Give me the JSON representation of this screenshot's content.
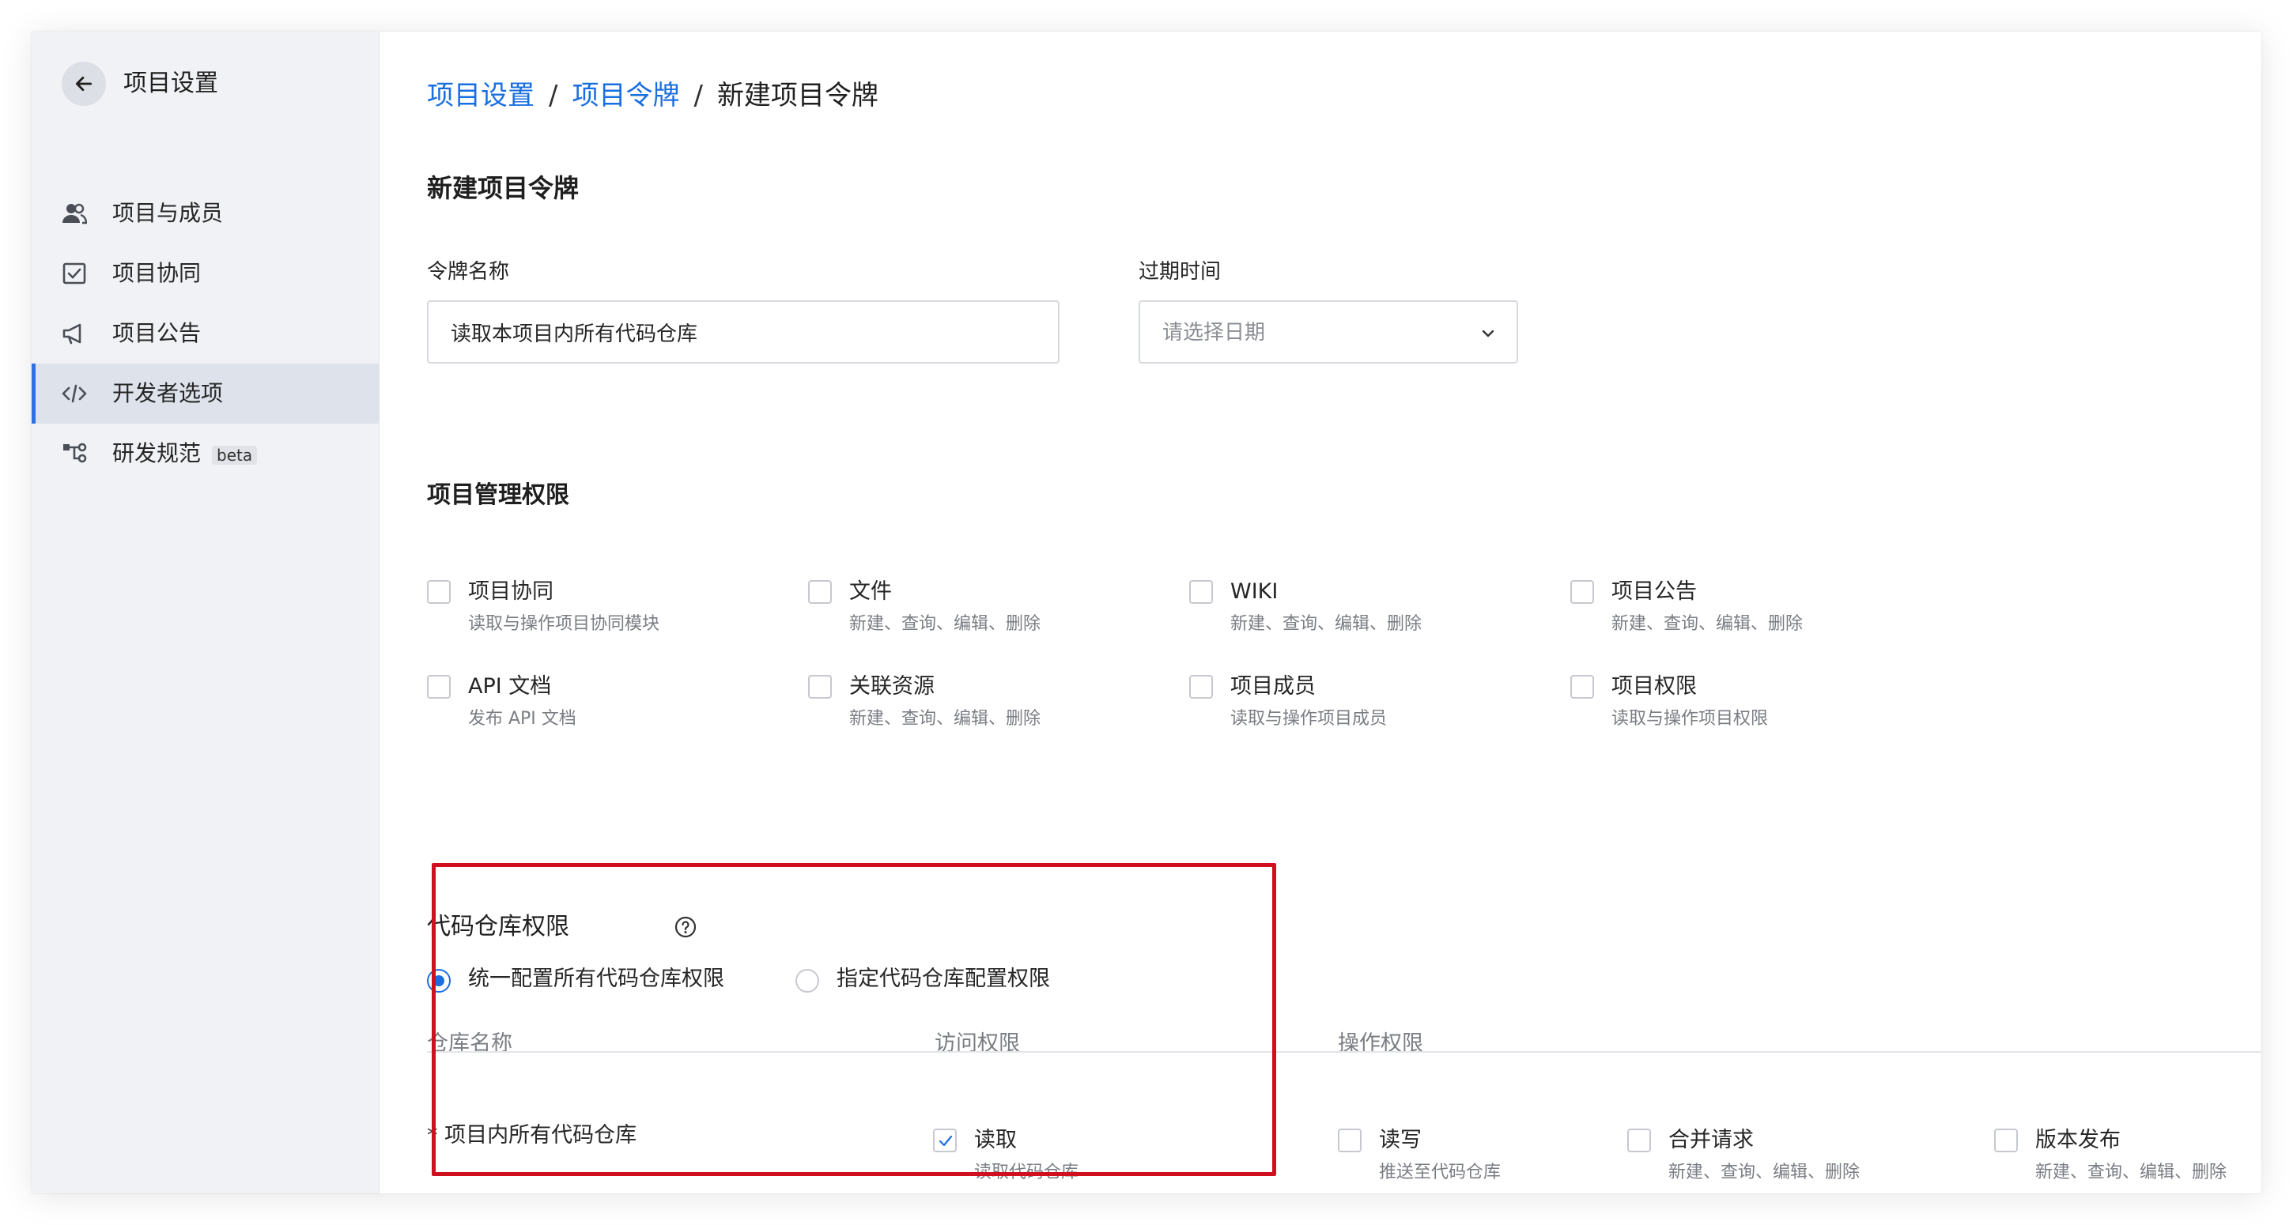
{
  "sidebar": {
    "title": "项目设置",
    "items": [
      {
        "label": "项目与成员",
        "icon": "members-icon"
      },
      {
        "label": "项目协同",
        "icon": "checklist-icon"
      },
      {
        "label": "项目公告",
        "icon": "megaphone-icon"
      },
      {
        "label": "开发者选项",
        "icon": "code-icon",
        "active": true
      },
      {
        "label": "研发规范",
        "icon": "workflow-icon",
        "badge": "beta"
      }
    ]
  },
  "breadcrumb": {
    "items": [
      "项目设置",
      "项目令牌"
    ],
    "separator": "/",
    "current": "新建项目令牌"
  },
  "page_title": "新建项目令牌",
  "form": {
    "token_name_label": "令牌名称",
    "token_name_value": "读取本项目内所有代码仓库",
    "expire_label": "过期时间",
    "expire_placeholder": "请选择日期"
  },
  "project_permissions": {
    "title": "项目管理权限",
    "items": [
      {
        "title": "项目协同",
        "desc": "读取与操作项目协同模块"
      },
      {
        "title": "文件",
        "desc": "新建、查询、编辑、删除"
      },
      {
        "title": "WIKI",
        "desc": "新建、查询、编辑、删除"
      },
      {
        "title": "项目公告",
        "desc": "新建、查询、编辑、删除"
      },
      {
        "title": "API 文档",
        "desc": "发布 API 文档"
      },
      {
        "title": "关联资源",
        "desc": "新建、查询、编辑、删除"
      },
      {
        "title": "项目成员",
        "desc": "读取与操作项目成员"
      },
      {
        "title": "项目权限",
        "desc": "读取与操作项目权限"
      }
    ]
  },
  "repo_permissions": {
    "title": "代码仓库权限",
    "radio_unified": "统一配置所有代码仓库权限",
    "radio_specific": "指定代码仓库配置权限",
    "columns": {
      "name": "仓库名称",
      "access": "访问权限",
      "operation": "操作权限"
    },
    "row": {
      "name": "* 项目内所有代码仓库",
      "access": {
        "title": "读取",
        "desc": "读取代码仓库",
        "checked": true
      },
      "operations": [
        {
          "title": "读写",
          "desc": "推送至代码仓库"
        },
        {
          "title": "合并请求",
          "desc": "新建、查询、编辑、删除"
        },
        {
          "title": "版本发布",
          "desc": "新建、查询、编辑、删除"
        }
      ]
    }
  },
  "colors": {
    "accent": "#1a6fe0",
    "highlight": "#d0101e",
    "sidebar_bg": "#f1f2f5"
  }
}
